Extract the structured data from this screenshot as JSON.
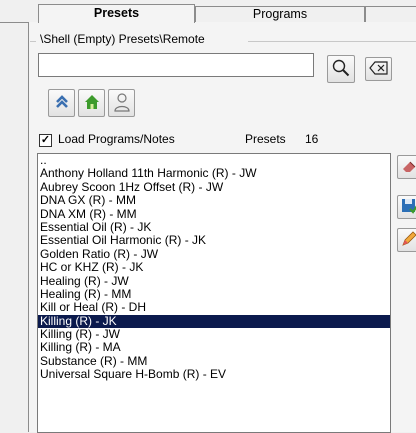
{
  "tabs": [
    {
      "label": "Presets",
      "active": true
    },
    {
      "label": "Programs",
      "active": false
    },
    {
      "label": "",
      "active": false
    }
  ],
  "path": "\\Shell (Empty) Presets\\Remote",
  "search": {
    "value": "",
    "placeholder": ""
  },
  "icons": {
    "search": "magnifier-icon",
    "clear": "backspace-clear-icon",
    "up": "double-chevron-up-icon",
    "home": "home-icon",
    "user": "user-icon",
    "side": [
      "delete-icon",
      "save-icon",
      "edit-icon"
    ]
  },
  "options": {
    "load_label": "Load Programs/Notes",
    "load_checked": true
  },
  "presets": {
    "label": "Presets",
    "count": "16"
  },
  "list": {
    "selected_index": 12,
    "items": [
      "..",
      "Anthony Holland 11th Harmonic (R) - JW",
      "Aubrey Scoon 1Hz Offset (R) - JW",
      "DNA GX (R) - MM",
      "DNA XM (R) - MM",
      "Essential Oil (R) - JK",
      "Essential Oil Harmonic (R) - JK",
      "Golden Ratio (R) - JW",
      "HC or KHZ (R) - JK",
      "Healing (R) - JW",
      "Healing (R) - MM",
      "Kill or Heal (R) - DH",
      "Killing (R) - JK",
      "Killing (R) - JW",
      "Killing (R) - MA",
      "Substance (R) - MM",
      "Universal Square H-Bomb (R) - EV"
    ]
  },
  "colors": {
    "selection": "#0b1a4d",
    "home_green": "#3d9b2c",
    "up_blue": "#3a6fb0"
  }
}
